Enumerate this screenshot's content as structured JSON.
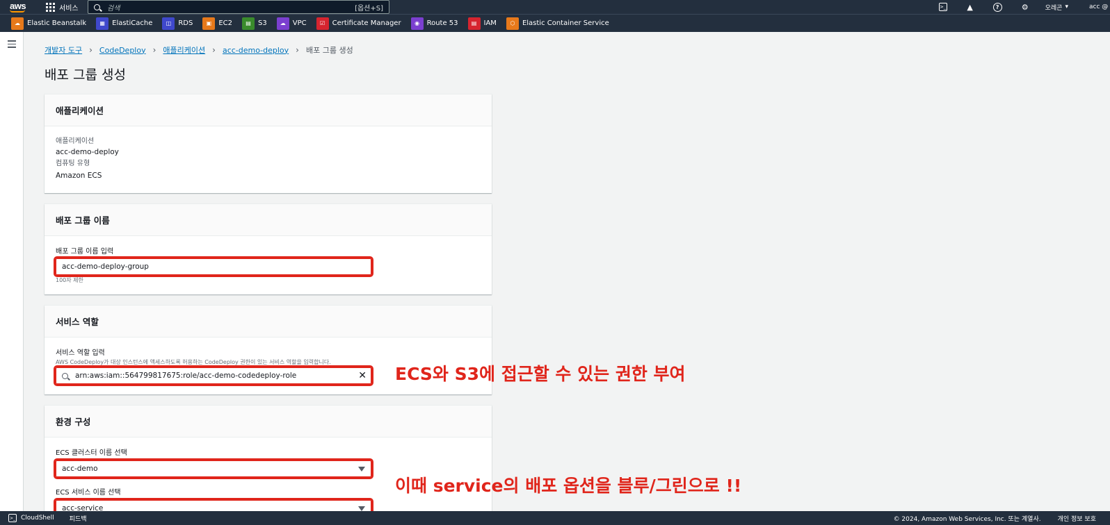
{
  "topnav": {
    "logo": "aws",
    "services_label": "서비스",
    "search_placeholder": "검색",
    "search_shortcut": "[옵션+S]",
    "region": "오레곤",
    "account": "acc @"
  },
  "favorites": [
    {
      "label": "Elastic Beanstalk",
      "icon": "beanstalk-icon",
      "color": "#e7791b"
    },
    {
      "label": "ElastiCache",
      "icon": "elasticache-icon",
      "color": "#3f48cc"
    },
    {
      "label": "RDS",
      "icon": "rds-icon",
      "color": "#3f48cc"
    },
    {
      "label": "EC2",
      "icon": "ec2-icon",
      "color": "#e7791b"
    },
    {
      "label": "S3",
      "icon": "s3-icon",
      "color": "#3a8b2c"
    },
    {
      "label": "VPC",
      "icon": "vpc-icon",
      "color": "#7b3fd0"
    },
    {
      "label": "Certificate Manager",
      "icon": "certificate-manager-icon",
      "color": "#d6242f"
    },
    {
      "label": "Route 53",
      "icon": "route53-icon",
      "color": "#7b3fd0"
    },
    {
      "label": "IAM",
      "icon": "iam-icon",
      "color": "#d6242f"
    },
    {
      "label": "Elastic Container Service",
      "icon": "ecs-icon",
      "color": "#e7791b"
    }
  ],
  "breadcrumb": {
    "items": [
      "개발자 도구",
      "CodeDeploy",
      "애플리케이션",
      "acc-demo-deploy"
    ],
    "current": "배포 그룹 생성"
  },
  "page_title": "배포 그룹 생성",
  "application_panel": {
    "header": "애플리케이션",
    "app_label": "애플리케이션",
    "app_value": "acc-demo-deploy",
    "compute_label": "컴퓨팅 유형",
    "compute_value": "Amazon ECS"
  },
  "group_name_panel": {
    "header": "배포 그룹 이름",
    "field_label": "배포 그룹 이름 입력",
    "value": "acc-demo-deploy-group",
    "constraint": "100자 제한"
  },
  "service_role_panel": {
    "header": "서비스 역할",
    "field_label": "서비스 역할 입력",
    "description": "AWS CodeDeploy가 대상 인스턴스에 액세스하도록 허용하는 CodeDeploy 권한이 있는 서비스 역할을 입력합니다.",
    "value": "arn:aws:iam::564799817675:role/acc-demo-codedeploy-role"
  },
  "environment_panel": {
    "header": "환경 구성",
    "cluster_label": "ECS 클러스터 이름 선택",
    "cluster_value": "acc-demo",
    "service_label": "ECS 서비스 이름 선택",
    "service_value": "acc-service"
  },
  "annotations": {
    "role_note": "ECS와 S3에 접근할 수 있는 권한 부여",
    "service_note": "이때 service의 배포 옵션을 블루/그린으로 !!",
    "color": "#e0251b"
  },
  "footer": {
    "cloudshell": "CloudShell",
    "feedback": "피드백",
    "copyright": "© 2024, Amazon Web Services, Inc. 또는 계열사.",
    "privacy": "개인 정보 보호"
  }
}
